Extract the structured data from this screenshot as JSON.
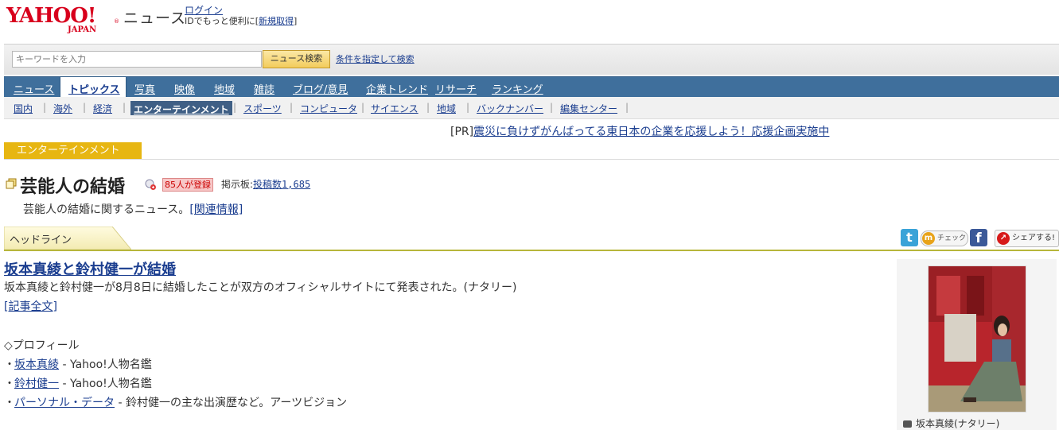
{
  "header": {
    "logo_text": "YAHOO!",
    "logo_sub": "JAPAN",
    "logo_reg": "®",
    "section": "ニュース",
    "login": "ログイン",
    "id_prefix": "IDでもっと便利に[",
    "signup": "新規取得",
    "id_suffix": "]"
  },
  "search": {
    "placeholder": "キーワードを入力",
    "button": "ニュース検索",
    "advanced": "条件を指定して検索"
  },
  "main_nav": [
    "ニュース",
    "トピックス",
    "写真",
    "映像",
    "地域",
    "雑誌",
    "ブログ/意見",
    "企業トレンド",
    "リサーチ",
    "ランキング"
  ],
  "sub_nav": [
    "国内",
    "海外",
    "経済",
    "エンターテインメント",
    "スポーツ",
    "コンピュータ",
    "サイエンス",
    "地域",
    "バックナンバー",
    "編集センター"
  ],
  "pr": {
    "tag": "[PR]",
    "link": "震災に負けずがんばってる東日本の企業を応援しよう！応援企画実施中"
  },
  "category": "エンターテインメント",
  "topic": {
    "title": "芸能人の結婚",
    "registered": "85人が登録",
    "board_label": "掲示板:",
    "board_count": "投稿数1,685",
    "desc": "芸能人の結婚に関するニュース。",
    "related": "[関連情報]"
  },
  "headline": "ヘッドライン",
  "social": {
    "twitter": "t",
    "mixi": "チェック",
    "facebook": "f",
    "share": "シェアする!"
  },
  "article": {
    "title": "坂本真綾と鈴村健一が結婚",
    "body": "坂本真綾と鈴村健一が8月8日に結婚したことが双方のオフィシャルサイトにて発表された。(ナタリー)",
    "full": "[記事全文]",
    "profile_head": "◇プロフィール",
    "profiles": [
      {
        "bullet": "・",
        "link": "坂本真綾",
        "text": " - Yahoo!人物名鑑"
      },
      {
        "bullet": "・",
        "link": "鈴村健一",
        "text": " - Yahoo!人物名鑑"
      },
      {
        "bullet": "・",
        "link": "パーソナル・データ",
        "text": " - 鈴村健一の主な出演歴など。アーツビジョン"
      }
    ]
  },
  "photo": {
    "caption": "坂本真綾(ナタリー)"
  }
}
